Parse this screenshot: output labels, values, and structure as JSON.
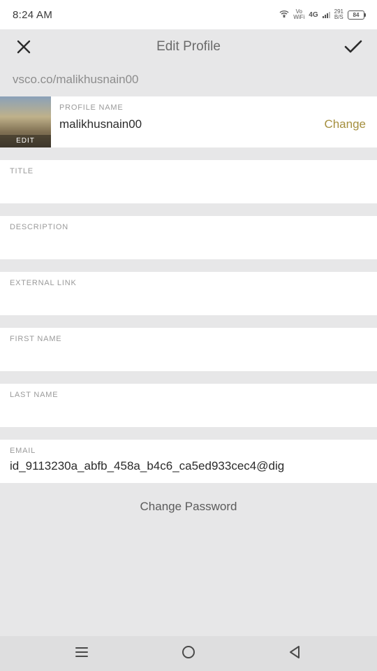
{
  "statusbar": {
    "time": "8:24 AM",
    "vo": "Vo",
    "wifi": "WiFi",
    "network": "4G",
    "speed_top": "291",
    "speed_bot": "B/S",
    "battery": "84"
  },
  "header": {
    "title": "Edit Profile"
  },
  "profile_url": "vsco.co/malikhusnain00",
  "avatar": {
    "edit_label": "EDIT"
  },
  "profile_name": {
    "label": "PROFILE NAME",
    "value": "malikhusnain00",
    "change_text": "Change"
  },
  "sections": {
    "title": {
      "label": "TITLE",
      "value": ""
    },
    "description": {
      "label": "DESCRIPTION",
      "value": ""
    },
    "external_link": {
      "label": "EXTERNAL LINK",
      "value": ""
    },
    "first_name": {
      "label": "FIRST NAME",
      "value": ""
    },
    "last_name": {
      "label": "LAST NAME",
      "value": ""
    },
    "email": {
      "label": "EMAIL",
      "value": "id_9113230a_abfb_458a_b4c6_ca5ed933cec4@dig"
    }
  },
  "change_password": "Change Password"
}
